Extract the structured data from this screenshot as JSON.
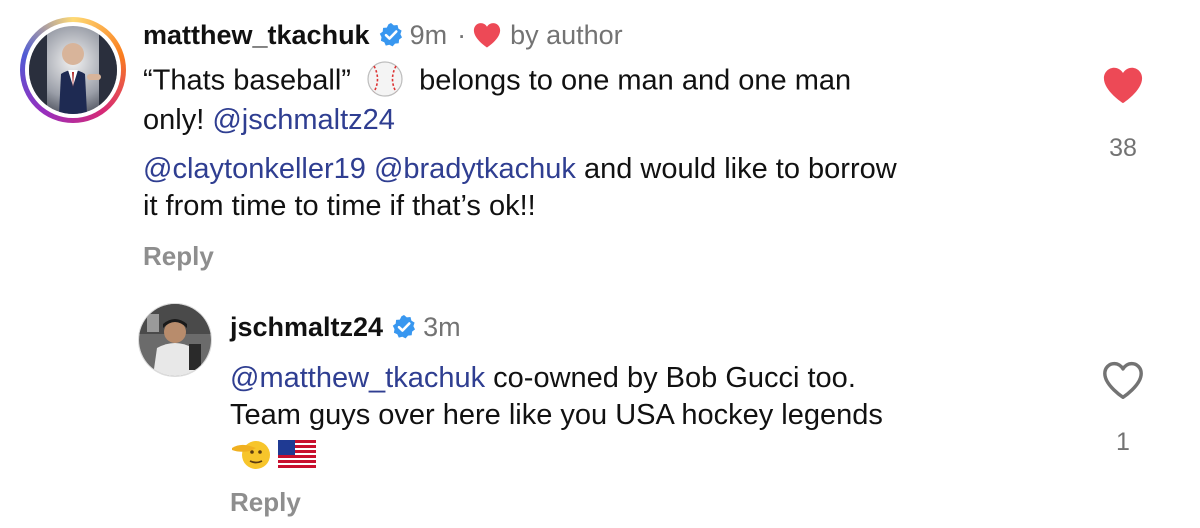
{
  "comments": [
    {
      "username": "matthew_tkachuk",
      "time": "9m",
      "separator": "·",
      "liked_by_author_label": "by author",
      "line1_before": "“Thats baseball”",
      "baseball_emoji": "⚾",
      "line1_after": "belongs to one man and one man",
      "line2_text": "only!",
      "line2_mention": "@jschmaltz24",
      "line3_mention1": "@claytonkeller19",
      "line3_mention2": "@bradytkachuk",
      "line3_text": "and would like to borrow",
      "line4_text": "it from time to time if that’s ok!!",
      "reply_label": "Reply",
      "like_count": "38",
      "liked": true
    },
    {
      "username": "jschmaltz24",
      "time": "3m",
      "line1_mention": "@matthew_tkachuk",
      "line1_text": "co-owned by Bob Gucci too.",
      "line2_text": "Team guys over here like you USA hockey legends",
      "salute_emoji": "🫡",
      "flag_emoji": "🇺🇸",
      "reply_label": "Reply",
      "like_count": "1",
      "liked": false
    }
  ],
  "colors": {
    "heart_red": "#ed4956",
    "verified_blue": "#3897f0",
    "mention_blue": "#2f3e91",
    "muted_gray": "#737373"
  },
  "icons": [
    "verified-badge-icon",
    "heart-filled-icon",
    "heart-outline-icon"
  ]
}
